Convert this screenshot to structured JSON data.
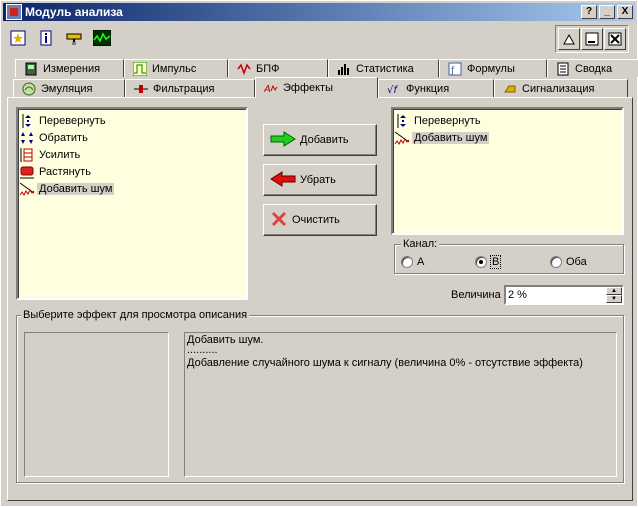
{
  "window": {
    "title": "Модуль анализа"
  },
  "titlebar_buttons": [
    "?",
    "_",
    "X"
  ],
  "toolbar": {
    "tools": [
      "star-icon",
      "info-icon",
      "ruler-icon",
      "scope-icon"
    ]
  },
  "right_toolbar": {
    "buttons": [
      "up-icon",
      "minimize-icon",
      "close-icon"
    ]
  },
  "tabs_top": [
    {
      "label": "Измерения",
      "icon": "meter-icon"
    },
    {
      "label": "Импульс",
      "icon": "pulse-icon"
    },
    {
      "label": "БПФ",
      "icon": "fft-icon"
    },
    {
      "label": "Статистика",
      "icon": "stats-icon"
    },
    {
      "label": "Формулы",
      "icon": "formula-icon"
    },
    {
      "label": "Сводка",
      "icon": "summary-icon"
    }
  ],
  "tabs_bottom": [
    {
      "label": "Эмуляция",
      "icon": "emulation-icon"
    },
    {
      "label": "Фильтрация",
      "icon": "filter-icon"
    },
    {
      "label": "Эффекты",
      "icon": "effects-icon",
      "active": true
    },
    {
      "label": "Функция",
      "icon": "function-icon"
    },
    {
      "label": "Сигнализация",
      "icon": "alarm-icon"
    }
  ],
  "available_effects": [
    {
      "label": "Перевернуть",
      "icon": "flip-icon"
    },
    {
      "label": "Обратить",
      "icon": "invert-icon"
    },
    {
      "label": "Усилить",
      "icon": "amplify-icon"
    },
    {
      "label": "Растянуть",
      "icon": "stretch-icon"
    },
    {
      "label": "Добавить шум",
      "icon": "noise-icon",
      "selected": true
    }
  ],
  "applied_effects": [
    {
      "label": "Перевернуть",
      "icon": "flip-icon"
    },
    {
      "label": "Добавить шум",
      "icon": "noise-icon",
      "selected": true
    }
  ],
  "buttons": {
    "add": "Добавить",
    "remove": "Убрать",
    "clear": "Очистить"
  },
  "channel": {
    "legend": "Канал:",
    "options": [
      {
        "label": "А",
        "checked": false
      },
      {
        "label": "В",
        "checked": true
      },
      {
        "label": "Оба",
        "checked": false
      }
    ]
  },
  "magnitude": {
    "label": "Величина",
    "value": "2 %"
  },
  "description": {
    "legend": "Выберите эффект для просмотра описания",
    "title": "Добавить шум.",
    "separator": "..........",
    "text": "Добавление случайного шума к сигналу (величина 0% - отсутствие эффекта)"
  }
}
